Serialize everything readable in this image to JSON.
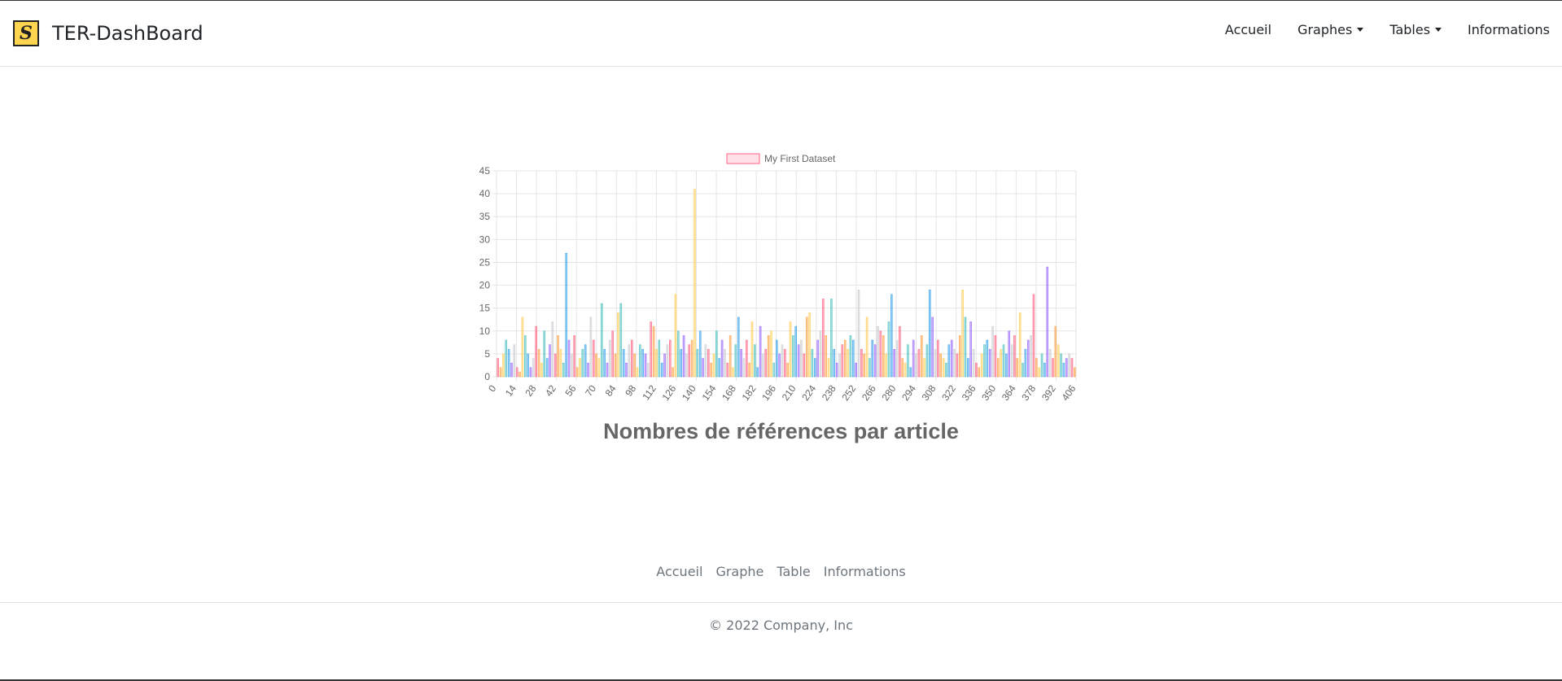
{
  "navbar": {
    "brand_letter": "S",
    "brand_name": "TER-DashBoard",
    "items": [
      {
        "label": "Accueil",
        "dropdown": false
      },
      {
        "label": "Graphes",
        "dropdown": true
      },
      {
        "label": "Tables",
        "dropdown": true
      },
      {
        "label": "Informations",
        "dropdown": false
      }
    ]
  },
  "chart_data": {
    "type": "bar",
    "series": [
      {
        "name": "My First Dataset",
        "color": "#ff6384",
        "fill": "#ffe0e6"
      }
    ],
    "legend_position": "top",
    "ylim": [
      0,
      45
    ],
    "y_ticks": [
      0,
      5,
      10,
      15,
      20,
      25,
      30,
      35,
      40,
      45
    ],
    "x_range": [
      0,
      406
    ],
    "x_tick_labels": [
      "0",
      "14",
      "28",
      "42",
      "56",
      "70",
      "84",
      "98",
      "112",
      "126",
      "140",
      "154",
      "168",
      "182",
      "196",
      "210",
      "224",
      "238",
      "252",
      "266",
      "280",
      "294",
      "308",
      "322",
      "336",
      "350",
      "364",
      "378",
      "392",
      "406"
    ],
    "grid": true,
    "bar_colors": [
      "#ff6384",
      "#ff9f40",
      "#ffcd56",
      "#4bc0c0",
      "#36a2eb",
      "#9966ff",
      "#c9cbcf"
    ],
    "values": [
      4,
      2,
      5,
      8,
      6,
      3,
      7,
      2,
      1,
      13,
      9,
      5,
      2,
      4,
      11,
      6,
      3,
      10,
      4,
      7,
      12,
      5,
      9,
      6,
      3,
      27,
      8,
      5,
      9,
      2,
      4,
      6,
      7,
      3,
      13,
      8,
      5,
      4,
      16,
      6,
      3,
      8,
      10,
      5,
      14,
      16,
      6,
      3,
      7,
      8,
      5,
      2,
      7,
      6,
      5,
      3,
      12,
      11,
      6,
      8,
      3,
      5,
      7,
      8,
      2,
      18,
      10,
      6,
      9,
      5,
      7,
      8,
      41,
      6,
      10,
      4,
      7,
      6,
      3,
      5,
      10,
      4,
      8,
      6,
      3,
      9,
      2,
      7,
      13,
      6,
      4,
      8,
      3,
      12,
      7,
      2,
      11,
      5,
      6,
      9,
      10,
      3,
      8,
      5,
      7,
      6,
      3,
      12,
      9,
      11,
      7,
      8,
      5,
      13,
      14,
      6,
      4,
      8,
      10,
      17,
      9,
      4,
      17,
      6,
      3,
      5,
      7,
      8,
      6,
      9,
      8,
      3,
      19,
      6,
      5,
      13,
      4,
      8,
      7,
      11,
      10,
      9,
      5,
      12,
      18,
      6,
      8,
      11,
      4,
      3,
      7,
      2,
      8,
      5,
      6,
      9,
      4,
      7,
      19,
      13,
      6,
      8,
      5,
      4,
      3,
      7,
      8,
      6,
      5,
      9,
      19,
      13,
      4,
      12,
      6,
      3,
      2,
      5,
      7,
      8,
      6,
      11,
      9,
      4,
      6,
      7,
      5,
      10,
      7,
      9,
      4,
      14,
      3,
      6,
      8,
      9,
      18,
      4,
      2,
      5,
      3,
      24,
      6,
      4,
      11,
      7,
      5,
      3,
      4,
      5,
      4,
      2
    ]
  },
  "chart_title": "Nombres de références par article",
  "footer": {
    "links": [
      "Accueil",
      "Graphe",
      "Table",
      "Informations"
    ],
    "copyright": "© 2022 Company, Inc"
  }
}
